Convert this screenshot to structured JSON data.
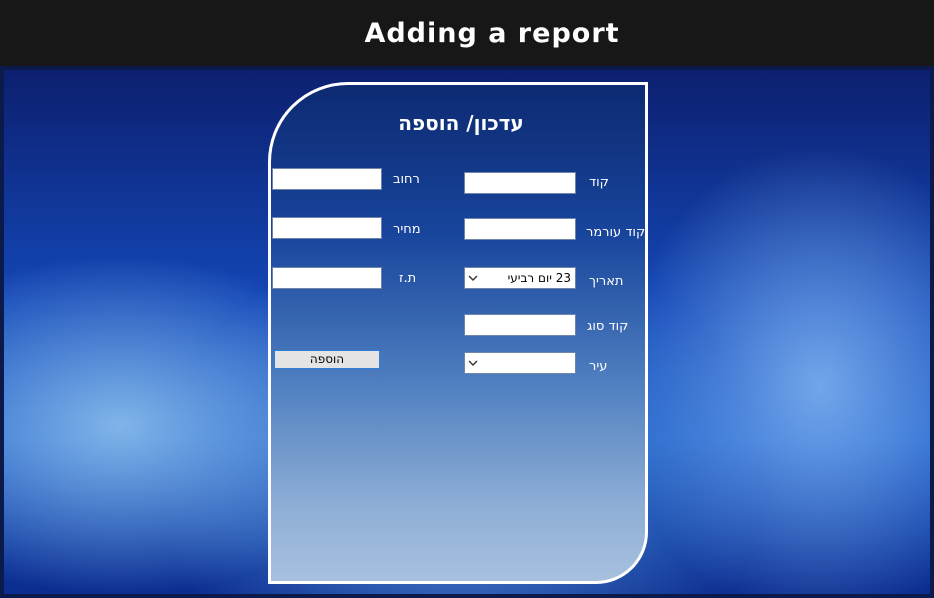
{
  "header": {
    "title": "Adding a report"
  },
  "form": {
    "title": "עדכון/ הוספה",
    "fields": {
      "code": {
        "label": "קוד",
        "value": ""
      },
      "witness_code": {
        "label": "קוד עורמר",
        "value": ""
      },
      "date": {
        "label": "תאריך",
        "value": "23 יום רביעי"
      },
      "type_code": {
        "label": "קוד סוג",
        "value": ""
      },
      "city": {
        "label": "עיר",
        "value": ""
      },
      "street": {
        "label": "רחוב",
        "value": ""
      },
      "price": {
        "label": "מחיר",
        "value": ""
      },
      "id": {
        "label": "ת.ז",
        "value": ""
      }
    },
    "add_button": "הוספה"
  },
  "icons": {
    "dropdown": "chevron-down-icon"
  },
  "colors": {
    "title_bar": "#171717",
    "panel_border": "#ffffff",
    "button_border": "#2f7fd8"
  }
}
